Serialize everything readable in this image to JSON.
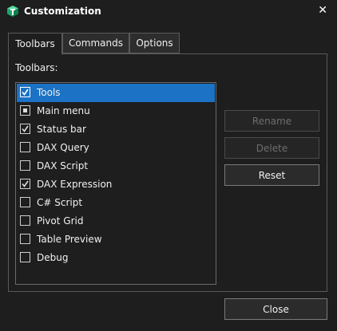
{
  "window": {
    "title": "Customization",
    "close_glyph": "✕",
    "icon": "cube-icon",
    "accent": "#1c72c4"
  },
  "tabs": [
    {
      "label": "Toolbars",
      "active": true
    },
    {
      "label": "Commands",
      "active": false
    },
    {
      "label": "Options",
      "active": false
    }
  ],
  "toolbars_label": "Toolbars:",
  "toolbars": [
    {
      "label": "Tools",
      "state": "checked",
      "selected": true
    },
    {
      "label": "Main menu",
      "state": "indeterminate",
      "selected": false
    },
    {
      "label": "Status bar",
      "state": "checked",
      "selected": false
    },
    {
      "label": "DAX Query",
      "state": "unchecked",
      "selected": false
    },
    {
      "label": "DAX Script",
      "state": "unchecked",
      "selected": false
    },
    {
      "label": "DAX Expression",
      "state": "checked",
      "selected": false
    },
    {
      "label": "C# Script",
      "state": "unchecked",
      "selected": false
    },
    {
      "label": "Pivot Grid",
      "state": "unchecked",
      "selected": false
    },
    {
      "label": "Table Preview",
      "state": "unchecked",
      "selected": false
    },
    {
      "label": "Debug",
      "state": "unchecked",
      "selected": false
    }
  ],
  "buttons": {
    "rename": {
      "label": "Rename",
      "enabled": false
    },
    "delete": {
      "label": "Delete",
      "enabled": false
    },
    "reset": {
      "label": "Reset",
      "enabled": true
    },
    "close": {
      "label": "Close",
      "enabled": true
    }
  }
}
